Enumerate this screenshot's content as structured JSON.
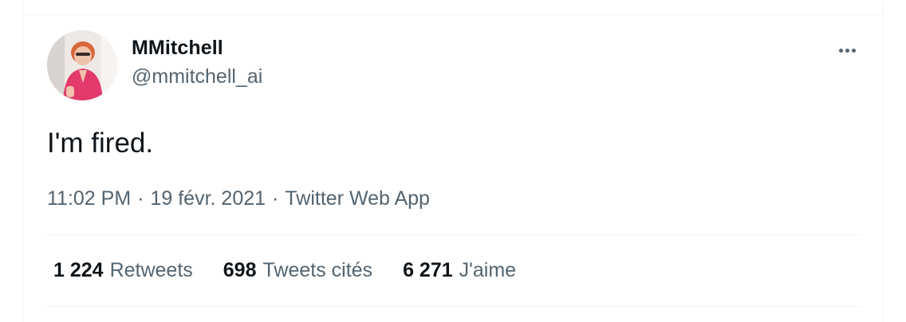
{
  "tweet": {
    "author": {
      "display_name": "MMitchell",
      "handle": "@mmitchell_ai",
      "avatar_icon": "profile-photo"
    },
    "text": "I'm fired.",
    "meta": {
      "time": "11:02 PM",
      "date": "19 févr. 2021",
      "source": "Twitter Web App",
      "separator": "·"
    },
    "stats": [
      {
        "count": "1 224",
        "label": "Retweets"
      },
      {
        "count": "698",
        "label": "Tweets cités"
      },
      {
        "count": "6 271",
        "label": "J'aime"
      }
    ],
    "more_icon": "ellipsis-icon"
  },
  "colors": {
    "text_primary": "#0f1419",
    "text_secondary": "#536471",
    "divider": "#eff3f4",
    "avatar_accent": "#e23a6a"
  }
}
